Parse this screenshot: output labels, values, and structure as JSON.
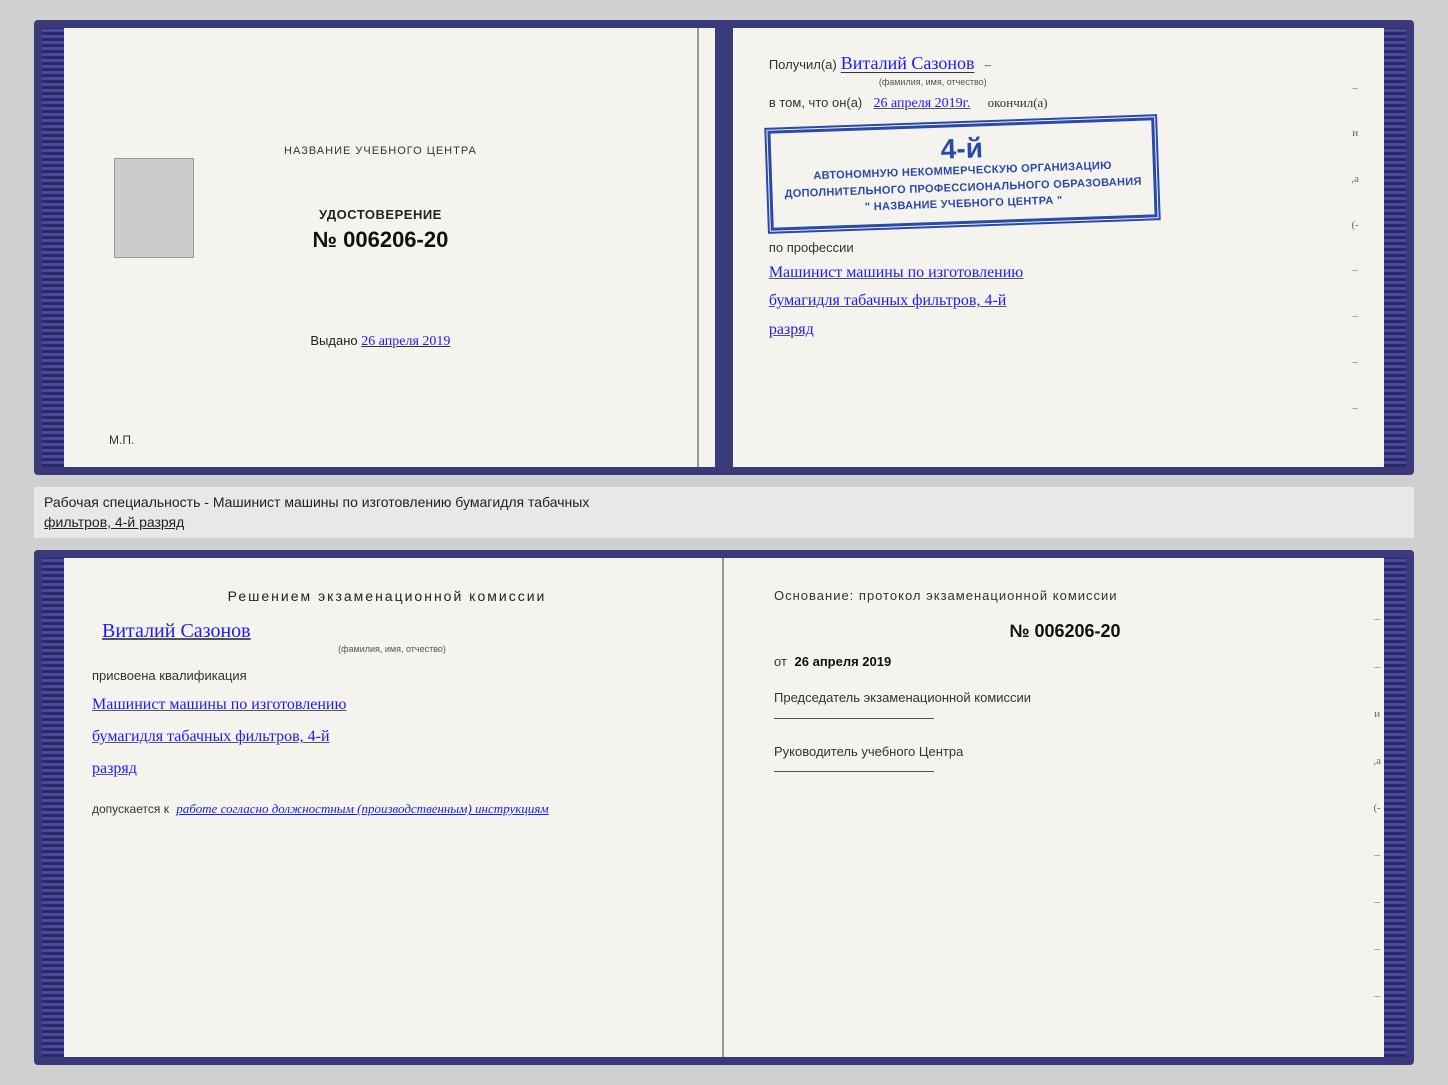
{
  "background_color": "#d0d0d0",
  "certificate_top": {
    "left_page": {
      "center_title": "НАЗВАНИЕ УЧЕБНОГО ЦЕНТРА",
      "cert_label": "УДОСТОВЕРЕНИЕ",
      "cert_number": "№ 006206-20",
      "issued_label": "Выдано",
      "issued_date": "26 апреля 2019",
      "mp_label": "М.П."
    },
    "right_page": {
      "received_prefix": "Получил(а)",
      "recipient_name": "Виталий Сазонов",
      "recipient_subtitle": "(фамилия, имя, отчество)",
      "vtom_prefix": "в том, что он(а)",
      "date_completed": "26 апреля 2019г.",
      "okoncil": "окончил(а)",
      "stamp_line1": "4-й",
      "stamp_line2": "АВТОНОМНУЮ НЕКОММЕРЧЕСКУЮ ОРГАНИЗАЦИЮ",
      "stamp_line3": "ДОПОЛНИТЕЛЬНОГО ПРОФЕССИОНАЛЬНОГО ОБРАЗОВАНИЯ",
      "stamp_line4": "\" НАЗВАНИЕ УЧЕБНОГО ЦЕНТРА \"",
      "profession_label": "по профессии",
      "profession_line1": "Машинист машины по изготовлению",
      "profession_line2": "бумагидля табачных фильтров, 4-й",
      "profession_line3": "разряд"
    }
  },
  "middle_section": {
    "text": "Рабочая специальность - Машинист машины по изготовлению бумагидля табачных",
    "text2": "фильтров, 4-й разряд"
  },
  "certificate_bottom": {
    "left_page": {
      "resolution_title": "Решением экзаменационной комиссии",
      "name": "Виталий Сазонов",
      "name_subtitle": "(фамилия, имя, отчество)",
      "assigned_label": "присвоена квалификация",
      "qualification_line1": "Машинист машины по изготовлению",
      "qualification_line2": "бумагидля табачных фильтров, 4-й",
      "qualification_line3": "разряд",
      "admitted_prefix": "допускается к",
      "admitted_text": "работе согласно должностным (производственным) инструкциям"
    },
    "right_page": {
      "osnova_label": "Основание: протокол экзаменационной комиссии",
      "protocol_number": "№ 006206-20",
      "from_prefix": "от",
      "from_date": "26 апреля 2019",
      "chairman_label": "Председатель экзаменационной комиссии",
      "director_label": "Руководитель учебного Центра"
    }
  },
  "dashes": [
    "-",
    "и",
    ",а",
    "(-",
    "-",
    "-",
    "-",
    "-"
  ]
}
